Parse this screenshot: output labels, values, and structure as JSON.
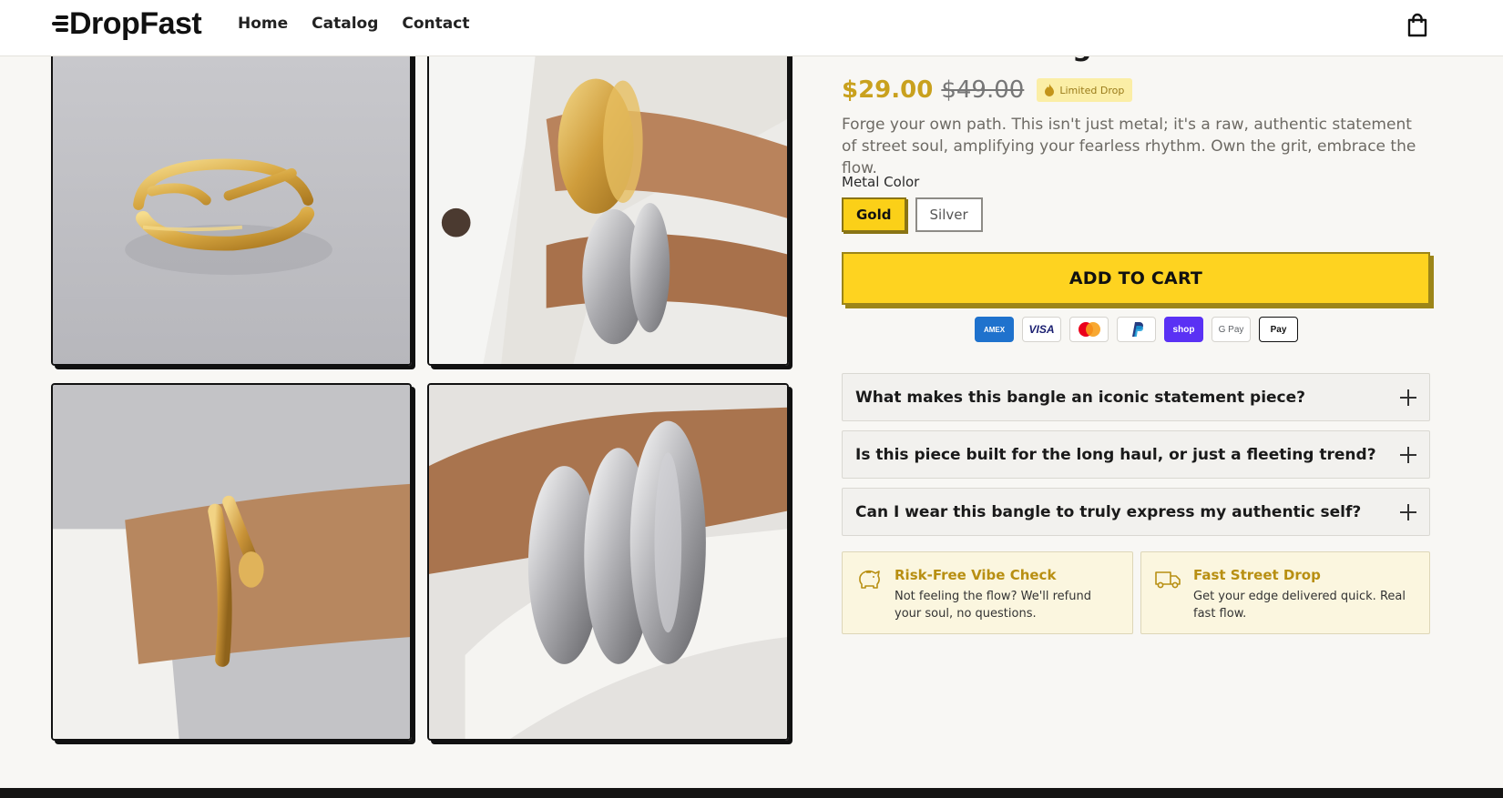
{
  "header": {
    "logo_text": "DropFast",
    "nav": [
      "Home",
      "Catalog",
      "Contact"
    ],
    "cart_icon": "shopping-bag-icon"
  },
  "product": {
    "title": "Statement Bangle",
    "price": "$29.00",
    "compare_price": "$49.00",
    "badge": "Limited Drop",
    "badge_icon": "flame-icon",
    "description": "Forge your own path. This isn't just metal; it's a raw, authentic statement of street soul, amplifying your fearless rhythm. Own the grit, embrace the flow.",
    "option_label": "Metal Color",
    "options": [
      "Gold",
      "Silver"
    ],
    "selected_option": "Gold",
    "add_to_cart": "ADD TO CART",
    "payment_methods": [
      "AMEX",
      "VISA",
      "Mastercard",
      "PayPal",
      "shop",
      "G Pay",
      "Pay"
    ]
  },
  "faqs": [
    "What makes this bangle an iconic statement piece?",
    "Is this piece built for the long haul, or just a fleeting trend?",
    "Can I wear this bangle to truly express my authentic self?"
  ],
  "perks": [
    {
      "title": "Risk-Free Vibe Check",
      "text": "Not feeling the flow? We'll refund your soul, no questions.",
      "icon": "piggy-bank-icon"
    },
    {
      "title": "Fast Street Drop",
      "text": "Get your edge delivered quick. Real fast flow.",
      "icon": "delivery-truck-icon"
    }
  ],
  "colors": {
    "accent": "#fed320",
    "price": "#c9a11e",
    "perk_title": "#b88f12"
  }
}
